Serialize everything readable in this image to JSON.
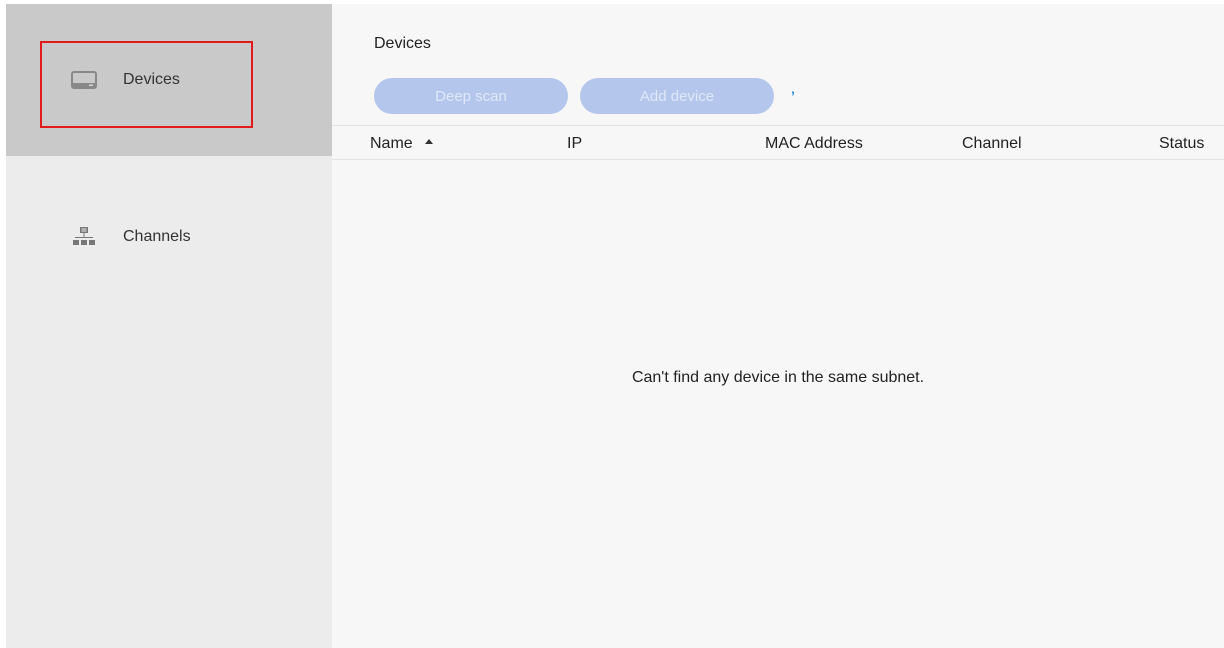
{
  "sidebar": {
    "items": [
      {
        "label": "Devices",
        "icon": "monitor-icon",
        "active": true
      },
      {
        "label": "Channels",
        "icon": "network-icon",
        "active": false
      }
    ]
  },
  "main": {
    "title": "Devices",
    "buttons": {
      "deep_scan": "Deep scan",
      "add_device": "Add device"
    },
    "table": {
      "columns": [
        "Name",
        "IP",
        "MAC Address",
        "Channel",
        "Status"
      ],
      "sort_column": "Name",
      "sort_direction": "ascending",
      "rows": []
    },
    "empty_message": "Can't find any device in the same subnet."
  },
  "colors": {
    "button_disabled": "#b4c6ec",
    "spinner": "#2d8be3",
    "highlight": "#e11b1b",
    "sidebar_active": "#c9c9c9"
  }
}
